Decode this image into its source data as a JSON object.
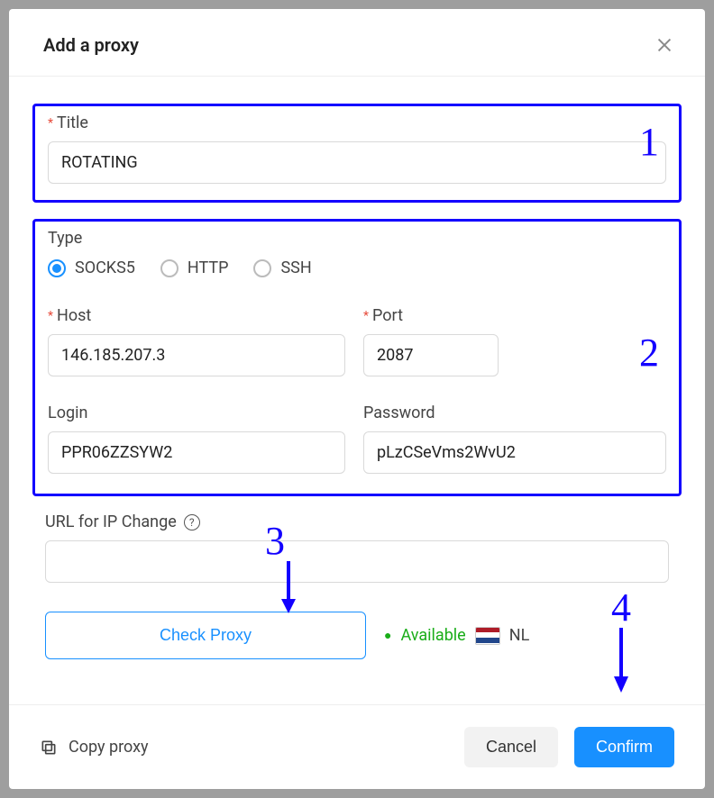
{
  "header": {
    "title": "Add a proxy"
  },
  "fields": {
    "title_label": "Title",
    "title_value": "ROTATING",
    "type_label": "Type",
    "type_options": [
      {
        "label": "SOCKS5",
        "checked": true
      },
      {
        "label": "HTTP",
        "checked": false
      },
      {
        "label": "SSH",
        "checked": false
      }
    ],
    "host_label": "Host",
    "host_value": "146.185.207.3",
    "port_label": "Port",
    "port_value": "2087",
    "login_label": "Login",
    "login_value": "PPR06ZZSYW2",
    "password_label": "Password",
    "password_value": "pLzCSeVms2WvU2",
    "url_label": "URL for IP Change",
    "url_value": ""
  },
  "actions": {
    "check_label": "Check Proxy",
    "status_text": "Available",
    "country_code": "NL"
  },
  "footer": {
    "copy_label": "Copy proxy",
    "cancel_label": "Cancel",
    "confirm_label": "Confirm"
  },
  "annotations": {
    "n1": "1",
    "n2": "2",
    "n3": "3",
    "n4": "4"
  }
}
